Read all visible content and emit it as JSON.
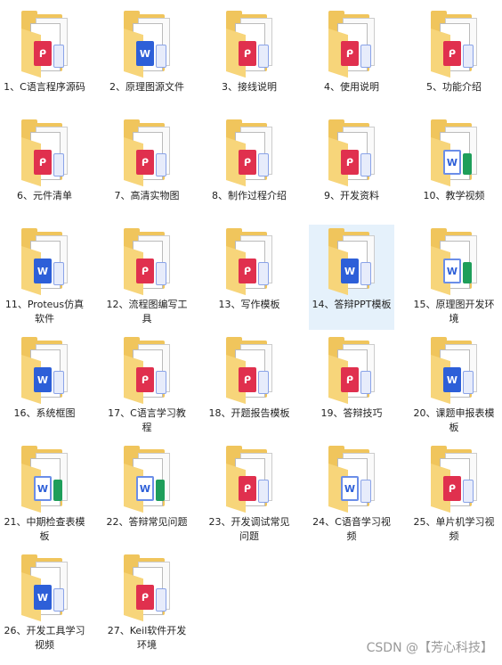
{
  "items": [
    {
      "label": "1、C语言程序源码",
      "type": "pdf"
    },
    {
      "label": "2、原理图源文件",
      "type": "word"
    },
    {
      "label": "3、接线说明",
      "type": "pdf"
    },
    {
      "label": "4、使用说明",
      "type": "pdf"
    },
    {
      "label": "5、功能介绍",
      "type": "pdf"
    },
    {
      "label": "6、元件清单",
      "type": "pdf"
    },
    {
      "label": "7、高清实物图",
      "type": "pdf"
    },
    {
      "label": "8、制作过程介绍",
      "type": "pdf"
    },
    {
      "label": "9、开发资料",
      "type": "pdf"
    },
    {
      "label": "10、教学视频",
      "type": "word-excel"
    },
    {
      "label": "11、Proteus仿真软件",
      "type": "word"
    },
    {
      "label": "12、流程图编写工具",
      "type": "pdf"
    },
    {
      "label": "13、写作模板",
      "type": "pdf"
    },
    {
      "label": "14、答辩PPT模板",
      "type": "word",
      "selected": true
    },
    {
      "label": "15、原理图开发环境",
      "type": "word-excel"
    },
    {
      "label": "16、系统框图",
      "type": "word"
    },
    {
      "label": "17、C语言学习教程",
      "type": "pdf"
    },
    {
      "label": "18、开题报告模板",
      "type": "pdf"
    },
    {
      "label": "19、答辩技巧",
      "type": "pdf"
    },
    {
      "label": "20、课题申报表模板",
      "type": "word"
    },
    {
      "label": "21、中期检查表模板",
      "type": "word-excel"
    },
    {
      "label": "22、答辩常见问题",
      "type": "word-excel"
    },
    {
      "label": "23、开发调试常见问题",
      "type": "pdf"
    },
    {
      "label": "24、C语音学习视频",
      "type": "word-outline"
    },
    {
      "label": "25、单片机学习视频",
      "type": "pdf"
    },
    {
      "label": "26、开发工具学习视频",
      "type": "word"
    },
    {
      "label": "27、Keil软件开发环境",
      "type": "pdf"
    }
  ],
  "watermark": "CSDN @【芳心科技】",
  "colors": {
    "folder": "#f0c55c",
    "pdf": "#e0304e",
    "word": "#2d5fd8",
    "excel": "#1e9e5a",
    "selection": "#e5f1fb"
  }
}
